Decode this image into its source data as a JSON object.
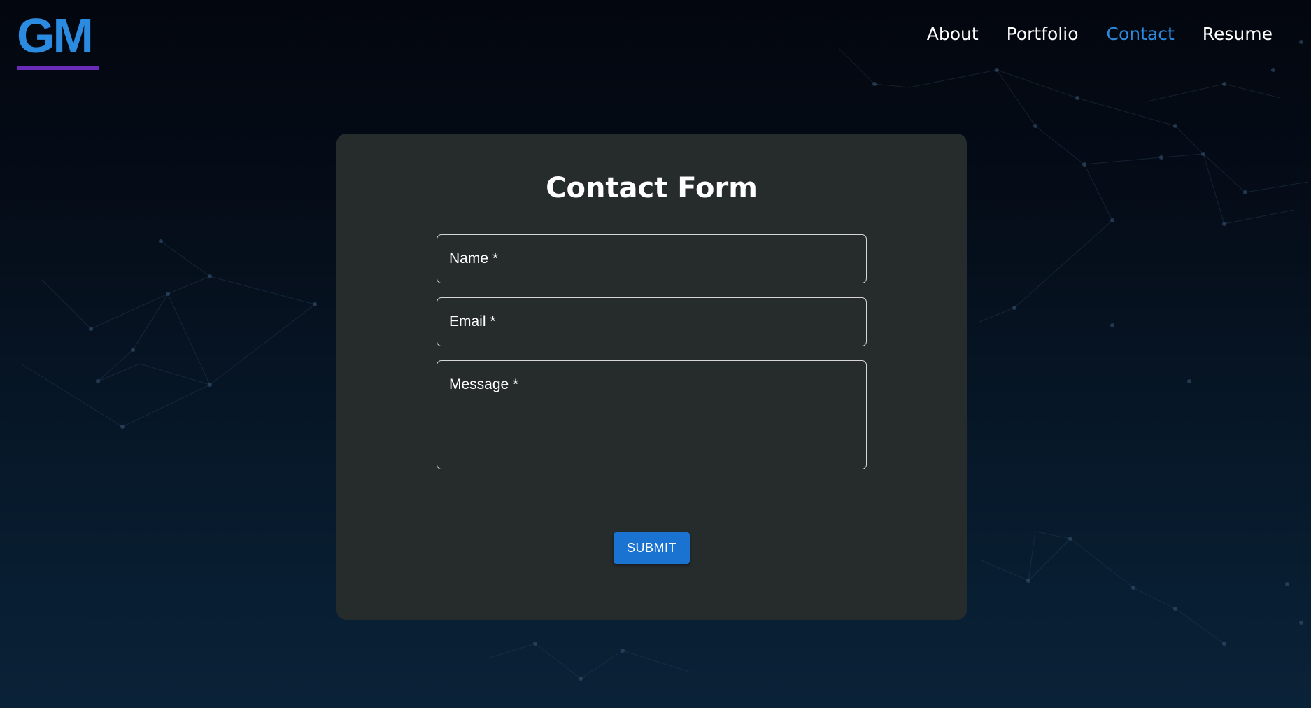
{
  "logo": {
    "text": "GM"
  },
  "nav": {
    "items": [
      {
        "label": "About"
      },
      {
        "label": "Portfolio"
      },
      {
        "label": "Contact"
      },
      {
        "label": "Resume"
      }
    ],
    "active": "Contact"
  },
  "contact_form": {
    "title": "Contact Form",
    "fields": {
      "name": {
        "label": "Name *",
        "value": ""
      },
      "email": {
        "label": "Email *",
        "value": ""
      },
      "message": {
        "label": "Message *",
        "value": ""
      }
    },
    "submit_label": "SUBMIT"
  },
  "colors": {
    "accent": "#2b8be0",
    "button": "#1a73d1",
    "logo_underline": "#6a2bb8",
    "card_background": "#262b2c",
    "page_background_top": "#03060e",
    "page_background_bottom": "#0a2238"
  }
}
